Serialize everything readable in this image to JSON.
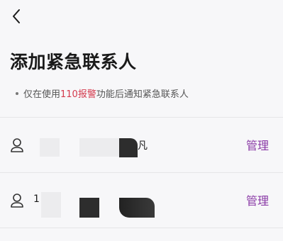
{
  "header": {
    "back_icon": "chevron-left-icon",
    "title": "添加紧急联系人",
    "note_prefix": "仅在使用",
    "note_highlight": "110报警",
    "note_suffix": "功能后通知紧急联系人",
    "highlight_color": "#d43a4d"
  },
  "contacts": [
    {
      "name_visible": "凡",
      "icon": "person-icon",
      "action": "管理"
    },
    {
      "name_visible": "1",
      "icon": "person-icon",
      "action": "管理"
    }
  ],
  "colors": {
    "accent": "#8a3aa6",
    "background": "#f7f7f9"
  }
}
